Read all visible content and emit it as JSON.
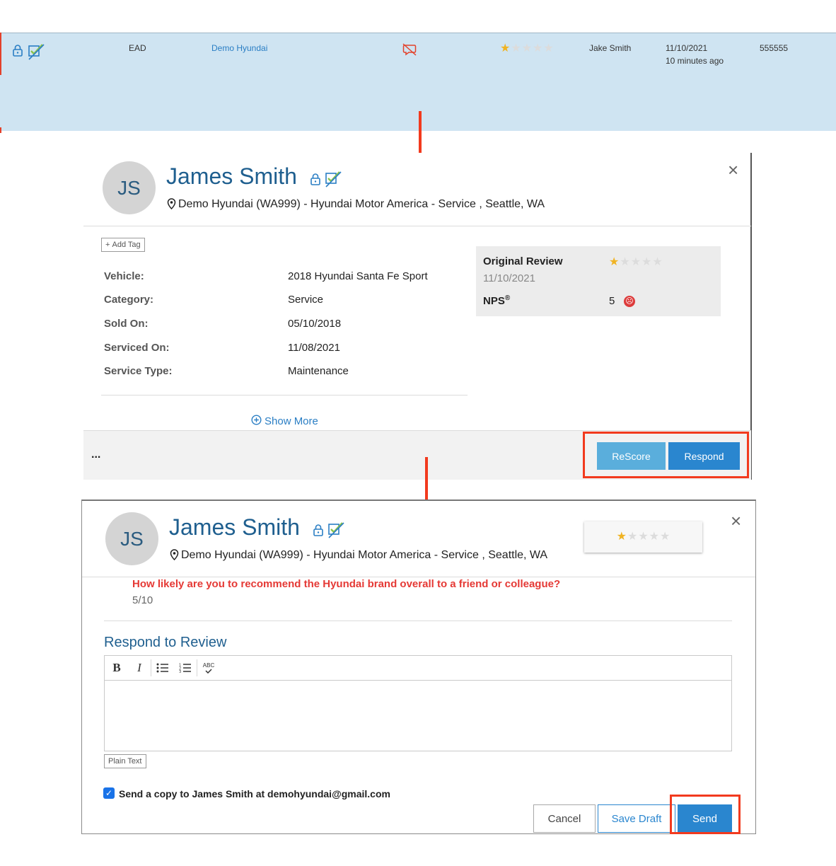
{
  "row": {
    "dealer_code": "EAD",
    "dealer_name": "Demo Hyundai",
    "rating": 1,
    "rating_max": 5,
    "assignee": "Jake Smith",
    "date": "11/10/2021",
    "relative_time": "10 minutes ago",
    "id": "555555",
    "icons": [
      "lock-icon",
      "verified-check-icon",
      "comment-off-icon"
    ]
  },
  "panel1": {
    "avatar_initials": "JS",
    "customer_name": "James Smith",
    "location": "Demo Hyundai (WA999) - Hyundai Motor America - Service , Seattle, WA",
    "close_label": "×",
    "add_tag_label": "Add Tag",
    "fields": [
      {
        "label": "Vehicle:",
        "value": "2018 Hyundai Santa Fe Sport"
      },
      {
        "label": "Category:",
        "value": "Service"
      },
      {
        "label": "Sold On:",
        "value": "05/10/2018"
      },
      {
        "label": "Serviced On:",
        "value": "11/08/2021"
      },
      {
        "label": "Service Type:",
        "value": "Maintenance"
      }
    ],
    "show_more_label": "Show More",
    "summary": {
      "original_review_label": "Original Review",
      "review_date": "11/10/2021",
      "rating": 1,
      "nps_label": "NPS",
      "nps_mark": "®",
      "nps_value": "5"
    },
    "more_label": "...",
    "rescore_label": "ReScore",
    "respond_label": "Respond"
  },
  "panel2": {
    "avatar_initials": "JS",
    "customer_name": "James Smith",
    "location": "Demo Hyundai (WA999) - Hyundai Motor America - Service , Seattle, WA",
    "close_label": "×",
    "rating": 1,
    "question": "How likely are you to recommend the Hyundai brand overall to a friend or colleague?",
    "answer": "5/10",
    "respond_heading": "Respond to Review",
    "toolbar": [
      "bold",
      "italic",
      "bulleted-list",
      "numbered-list",
      "spellcheck"
    ],
    "toolbar_glyphs": {
      "bold": "B",
      "italic": "I",
      "bulleted": "≡",
      "numbered": "≡",
      "spell": "ABC"
    },
    "editor_value": "",
    "plain_text_label": "Plain Text",
    "send_copy_checked": true,
    "send_copy_label": "Send a copy to James Smith at demohyundai@gmail.com",
    "cancel_label": "Cancel",
    "save_draft_label": "Save Draft",
    "send_label": "Send"
  },
  "colors": {
    "row_bg": "#cfe4f2",
    "accent": "#2a86cf",
    "highlight_red": "#f23a1e",
    "star_on": "#f0b323",
    "question_red": "#e53935"
  }
}
